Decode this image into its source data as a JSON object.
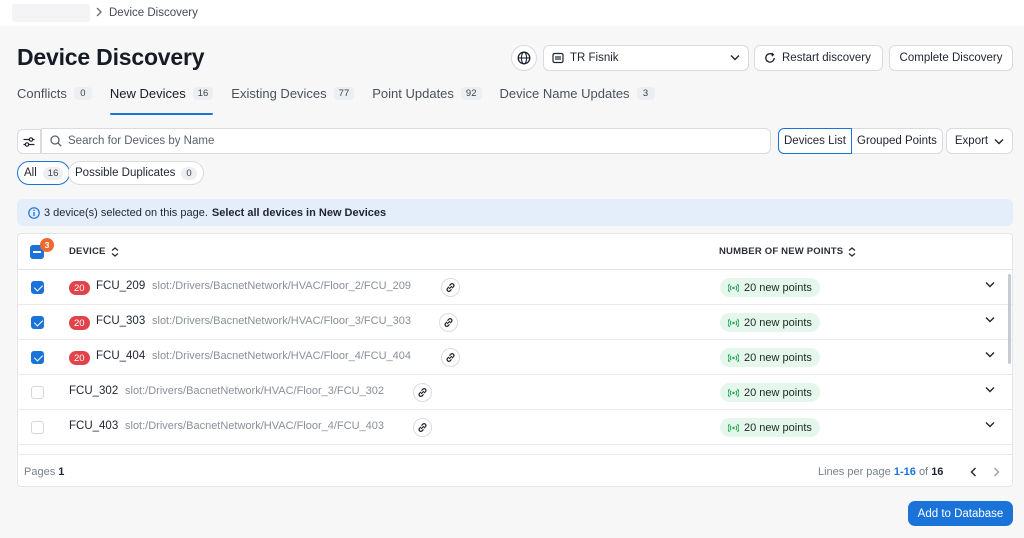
{
  "breadcrumb": {
    "current": "Device Discovery"
  },
  "page_title": "Device Discovery",
  "header": {
    "site_select": "TR Fisnik",
    "restart_label": "Restart discovery",
    "complete_label": "Complete Discovery"
  },
  "tabs": [
    {
      "label": "Conflicts",
      "count": "0"
    },
    {
      "label": "New Devices",
      "count": "16"
    },
    {
      "label": "Existing Devices",
      "count": "77"
    },
    {
      "label": "Point Updates",
      "count": "92"
    },
    {
      "label": "Device Name Updates",
      "count": "3"
    }
  ],
  "search": {
    "placeholder": "Search for Devices by Name"
  },
  "view_toggle": {
    "list": "Devices List",
    "grouped": "Grouped Points"
  },
  "export_label": "Export",
  "filters": {
    "all_label": "All",
    "all_count": "16",
    "dup_label": "Possible Duplicates",
    "dup_count": "0"
  },
  "info": {
    "text": "3 device(s) selected on this page.",
    "action": "Select all devices in New Devices"
  },
  "table": {
    "selected_count": "3",
    "col_device": "DEVICE",
    "col_points": "NUMBER OF NEW POINTS",
    "rows": [
      {
        "badge": "20",
        "name": "FCU_209",
        "path": "slot:/Drivers/BacnetNetwork/HVAC/Floor_2/FCU_209",
        "points": "20 new points",
        "checked": true
      },
      {
        "badge": "20",
        "name": "FCU_303",
        "path": "slot:/Drivers/BacnetNetwork/HVAC/Floor_3/FCU_303",
        "points": "20 new points",
        "checked": true
      },
      {
        "badge": "20",
        "name": "FCU_404",
        "path": "slot:/Drivers/BacnetNetwork/HVAC/Floor_4/FCU_404",
        "points": "20 new points",
        "checked": true
      },
      {
        "badge": "",
        "name": "FCU_302",
        "path": "slot:/Drivers/BacnetNetwork/HVAC/Floor_3/FCU_302",
        "points": "20 new points",
        "checked": false
      },
      {
        "badge": "",
        "name": "FCU_403",
        "path": "slot:/Drivers/BacnetNetwork/HVAC/Floor_4/FCU_403",
        "points": "20 new points",
        "checked": false
      }
    ]
  },
  "footer": {
    "pages_label": "Pages",
    "pages_value": "1",
    "lines_label": "Lines per page",
    "range": "1-16",
    "of_label": "of",
    "total": "16"
  },
  "add_button": "Add to Database",
  "colors": {
    "accent": "#1a73d9",
    "badge_red": "#e2424a",
    "badge_orange": "#ee6a2e",
    "points_green": "#20a454"
  },
  "icons": [
    "chevron-right-icon",
    "globe-icon",
    "building-icon",
    "chevron-down-icon",
    "refresh-icon",
    "filter-icon",
    "search-icon",
    "info-icon",
    "sort-icon",
    "link-icon",
    "broadcast-icon",
    "chevron-left-icon"
  ]
}
